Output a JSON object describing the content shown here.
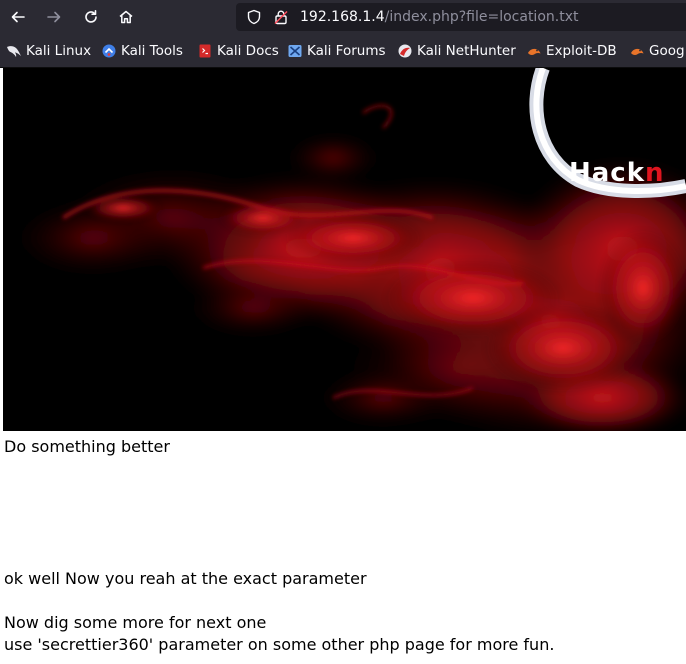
{
  "browser": {
    "url_host": "192.168.1.4",
    "url_path": "/index.php?file=location.txt",
    "bookmarks": [
      {
        "label": "Kali Linux",
        "icon": "kali-dragon-icon"
      },
      {
        "label": "Kali Tools",
        "icon": "kali-tools-icon"
      },
      {
        "label": "Kali Docs",
        "icon": "kali-docs-icon"
      },
      {
        "label": "Kali Forums",
        "icon": "kali-forums-icon"
      },
      {
        "label": "Kali NetHunter",
        "icon": "nethunter-icon"
      },
      {
        "label": "Exploit-DB",
        "icon": "exploit-db-icon"
      },
      {
        "label": "Goog",
        "icon": "google-hacking-icon"
      }
    ]
  },
  "page": {
    "banner_brand": "Hackn",
    "line1": "Do something better",
    "line2": "ok well Now you reah at the exact parameter",
    "line3": "Now dig some more for next one",
    "line4": "use 'secrettier360' parameter on some other php page for more fun."
  },
  "colors": {
    "chrome_bg": "#2b2a33",
    "urlbar_bg": "#1c1b22",
    "smoke_red": "#c0121a",
    "brand_accent": "#e0141e"
  }
}
